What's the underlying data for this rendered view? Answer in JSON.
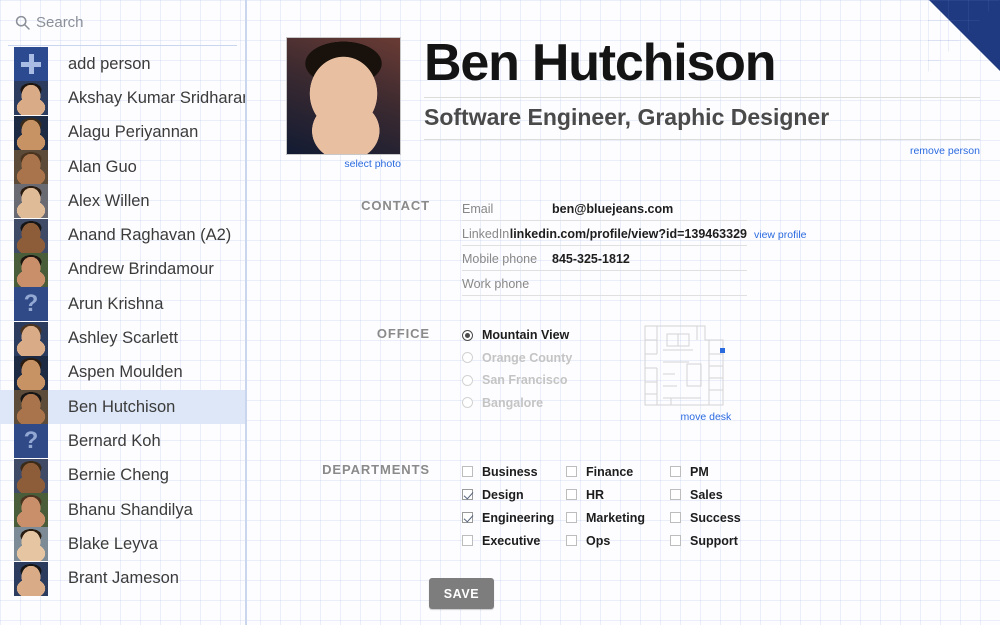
{
  "search": {
    "placeholder": "Search",
    "value": "",
    "icon": "search-icon"
  },
  "sidebar": {
    "add_person": {
      "label": "add person",
      "icon": "plus-icon"
    },
    "people": [
      {
        "name": "Akshay Kumar Sridharan",
        "avatar": "photo",
        "selected": false
      },
      {
        "name": "Alagu Periyannan",
        "avatar": "photo",
        "selected": false
      },
      {
        "name": "Alan Guo",
        "avatar": "photo",
        "selected": false
      },
      {
        "name": "Alex Willen",
        "avatar": "photo",
        "selected": false
      },
      {
        "name": "Anand Raghavan (A2)",
        "avatar": "photo",
        "selected": false
      },
      {
        "name": "Andrew Brindamour",
        "avatar": "photo",
        "selected": false
      },
      {
        "name": "Arun Krishna",
        "avatar": "placeholder",
        "selected": false
      },
      {
        "name": "Ashley Scarlett",
        "avatar": "photo",
        "selected": false
      },
      {
        "name": "Aspen Moulden",
        "avatar": "photo",
        "selected": false
      },
      {
        "name": "Ben Hutchison",
        "avatar": "photo",
        "selected": true
      },
      {
        "name": "Bernard Koh",
        "avatar": "placeholder",
        "selected": false
      },
      {
        "name": "Bernie Cheng",
        "avatar": "photo",
        "selected": false
      },
      {
        "name": "Bhanu Shandilya",
        "avatar": "photo",
        "selected": false
      },
      {
        "name": "Blake Leyva",
        "avatar": "photo",
        "selected": false
      },
      {
        "name": "Brant Jameson",
        "avatar": "photo",
        "selected": false
      }
    ],
    "placeholder_glyph": "?"
  },
  "profile": {
    "name": "Ben Hutchison",
    "subtitle": "Software Engineer, Graphic Designer",
    "select_photo_label": "select photo",
    "remove_person_label": "remove person"
  },
  "contact": {
    "label": "CONTACT",
    "fields": [
      {
        "label": "Email",
        "value": "ben@bluejeans.com",
        "link": ""
      },
      {
        "label": "LinkedIn",
        "value": "linkedin.com/profile/view?id=139463329",
        "link": "view profile"
      },
      {
        "label": "Mobile phone",
        "value": "845-325-1812",
        "link": ""
      },
      {
        "label": "Work phone",
        "value": "",
        "link": ""
      }
    ]
  },
  "office": {
    "label": "OFFICE",
    "options": [
      {
        "label": "Mountain View",
        "selected": true
      },
      {
        "label": "Orange County",
        "selected": false
      },
      {
        "label": "San Francisco",
        "selected": false
      },
      {
        "label": "Bangalore",
        "selected": false
      }
    ],
    "move_desk_label": "move desk",
    "desk_marker_color": "#2a6adf"
  },
  "departments": {
    "label": "DEPARTMENTS",
    "items": [
      {
        "label": "Business",
        "checked": false
      },
      {
        "label": "Design",
        "checked": true
      },
      {
        "label": "Engineering",
        "checked": true
      },
      {
        "label": "Executive",
        "checked": false
      },
      {
        "label": "Finance",
        "checked": false
      },
      {
        "label": "HR",
        "checked": false
      },
      {
        "label": "Marketing",
        "checked": false
      },
      {
        "label": "Ops",
        "checked": false
      },
      {
        "label": "PM",
        "checked": false
      },
      {
        "label": "Sales",
        "checked": false
      },
      {
        "label": "Success",
        "checked": false
      },
      {
        "label": "Support",
        "checked": false
      }
    ]
  },
  "actions": {
    "save_label": "SAVE"
  },
  "colors": {
    "accent_link": "#2a6adf",
    "selected_row": "#dde7f7",
    "fold_corner": "#1f3a80",
    "avatar_placeholder_bg": "#2f4a87",
    "save_button": "#7d7d7d"
  }
}
